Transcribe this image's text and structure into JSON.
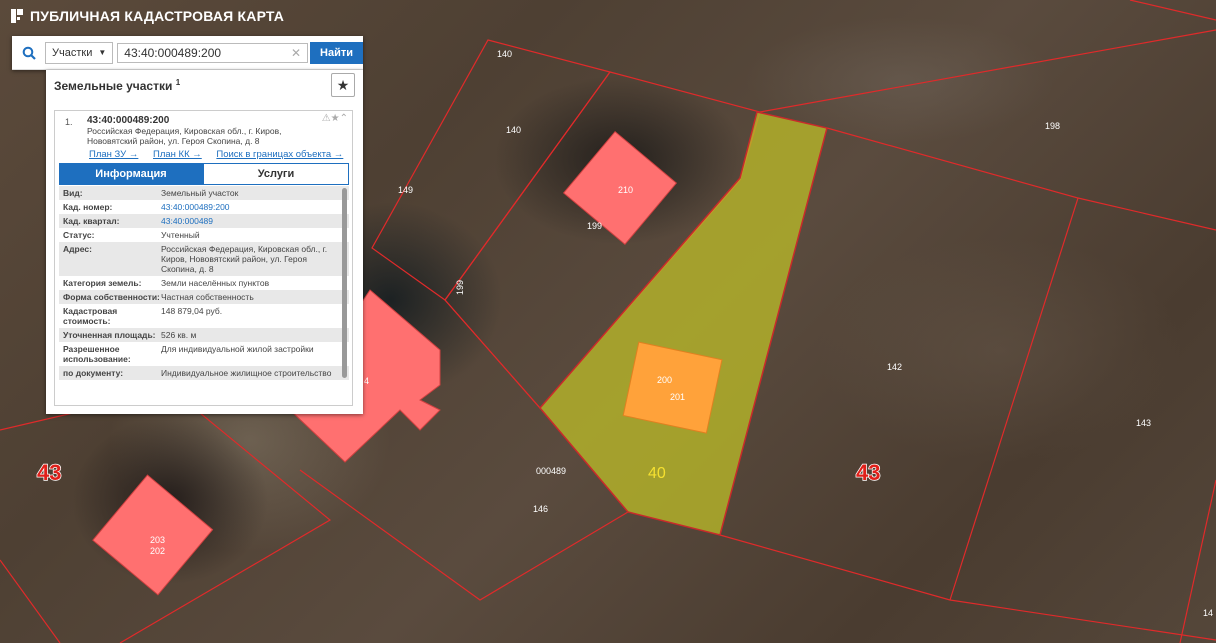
{
  "app": {
    "title": "ПУБЛИЧНАЯ КАДАСТРОВАЯ КАРТА"
  },
  "search": {
    "type_label": "Участки",
    "value": "43:40:000489:200",
    "button": "Найти"
  },
  "panel": {
    "title": "Земельные участки",
    "count": "1"
  },
  "result": {
    "index": "1.",
    "cad_number": "43:40:000489:200",
    "address": "Российская Федерация, Кировская обл., г. Киров, Нововятский район, ул. Героя Скопина, д. 8",
    "links": [
      "План ЗУ →",
      "План КК →",
      "Поиск в границах объекта →"
    ],
    "tabs": [
      "Информация",
      "Услуги"
    ],
    "info_rows": [
      {
        "k": "Вид:",
        "v": "Земельный участок"
      },
      {
        "k": "Кад. номер:",
        "v": "43:40:000489:200"
      },
      {
        "k": "Кад. квартал:",
        "v": "43:40:000489"
      },
      {
        "k": "Статус:",
        "v": "Учтенный"
      },
      {
        "k": "Адрес:",
        "v": "Российская Федерация, Кировская обл., г. Киров, Нововятский район, ул. Героя Скопина, д. 8"
      },
      {
        "k": "Категория земель:",
        "v": "Земли населённых пунктов"
      },
      {
        "k": "Форма собственности:",
        "v": "Частная собственность"
      },
      {
        "k": "Кадастровая стоимость:",
        "v": "148 879,04 руб."
      },
      {
        "k": "Уточненная площадь:",
        "v": "526 кв. м"
      },
      {
        "k": "Разрешенное использование:",
        "v": "Для индивидуальной жилой застройки"
      },
      {
        "k": "по документу:",
        "v": "Индивидуальное жилищное строительство"
      }
    ]
  },
  "map": {
    "labels": {
      "l140a": "140",
      "l140b": "140",
      "l198": "198",
      "l149": "149",
      "l210": "210",
      "l199": "199",
      "l199v": "199",
      "l200": "200",
      "l201": "201",
      "l142": "142",
      "l143": "143",
      "l146": "146",
      "l000489": "000489",
      "l40": "40",
      "l43a": "43",
      "l43b": "43",
      "l203": "203",
      "l202": "202",
      "l4": "4",
      "l14": "14"
    }
  }
}
